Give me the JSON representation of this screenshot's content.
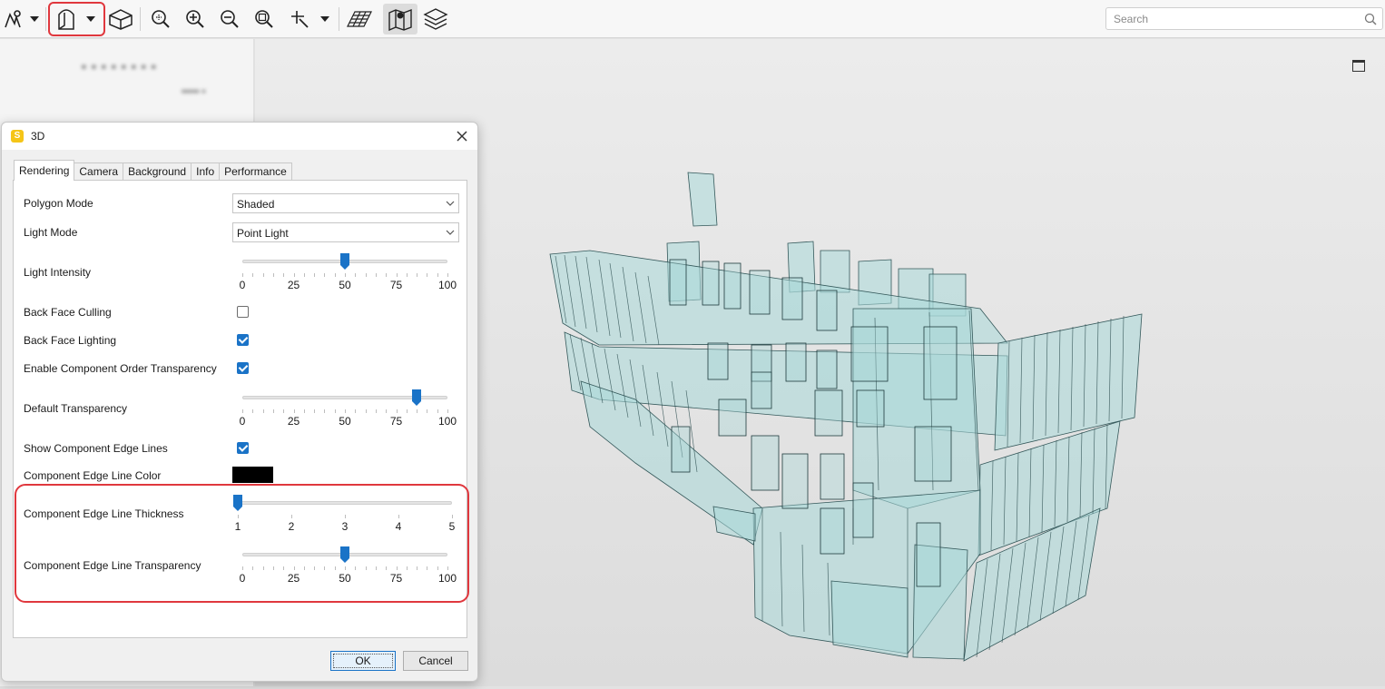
{
  "toolbar": {
    "search_placeholder": "Search",
    "icons": [
      "pin-tool-icon",
      "chevron-down-icon",
      "viewer-3d-icon",
      "chevron-down-icon",
      "cube-icon",
      "zoom-extents-icon",
      "zoom-in-icon",
      "zoom-out-icon",
      "zoom-window-icon",
      "select-tool-icon",
      "chevron-down-icon",
      "grid-plane-icon",
      "map-icon",
      "layers-icon"
    ]
  },
  "dialog": {
    "title": "3D",
    "logo": "S",
    "tabs": [
      "Rendering",
      "Camera",
      "Background",
      "Info",
      "Performance"
    ],
    "active_tab": "Rendering",
    "polygon_mode": {
      "label": "Polygon Mode",
      "value": "Shaded"
    },
    "light_mode": {
      "label": "Light Mode",
      "value": "Point Light"
    },
    "light_intensity": {
      "label": "Light Intensity",
      "value": 50,
      "ticks": [
        "0",
        "25",
        "50",
        "75",
        "100"
      ]
    },
    "back_face_culling": {
      "label": "Back Face Culling",
      "checked": false
    },
    "back_face_lighting": {
      "label": "Back Face Lighting",
      "checked": true
    },
    "component_order_transparency": {
      "label": "Enable Component Order Transparency",
      "checked": true
    },
    "default_transparency": {
      "label": "Default Transparency",
      "value": 85,
      "ticks": [
        "0",
        "25",
        "50",
        "75",
        "100"
      ]
    },
    "show_edge_lines": {
      "label": "Show Component Edge Lines",
      "checked": true
    },
    "edge_line_color": {
      "label": "Component Edge Line Color",
      "color": "#000000"
    },
    "edge_line_thickness": {
      "label": "Component Edge Line Thickness",
      "value": 1,
      "ticks": [
        "1",
        "2",
        "3",
        "4",
        "5"
      ]
    },
    "edge_line_transparency": {
      "label": "Component Edge Line Transparency",
      "value": 50,
      "ticks": [
        "0",
        "25",
        "50",
        "75",
        "100"
      ]
    },
    "ok_label": "OK",
    "cancel_label": "Cancel"
  },
  "colors": {
    "accent": "#1a73c7",
    "highlight": "#e0383e",
    "model_fill": "#a9d8d8"
  }
}
